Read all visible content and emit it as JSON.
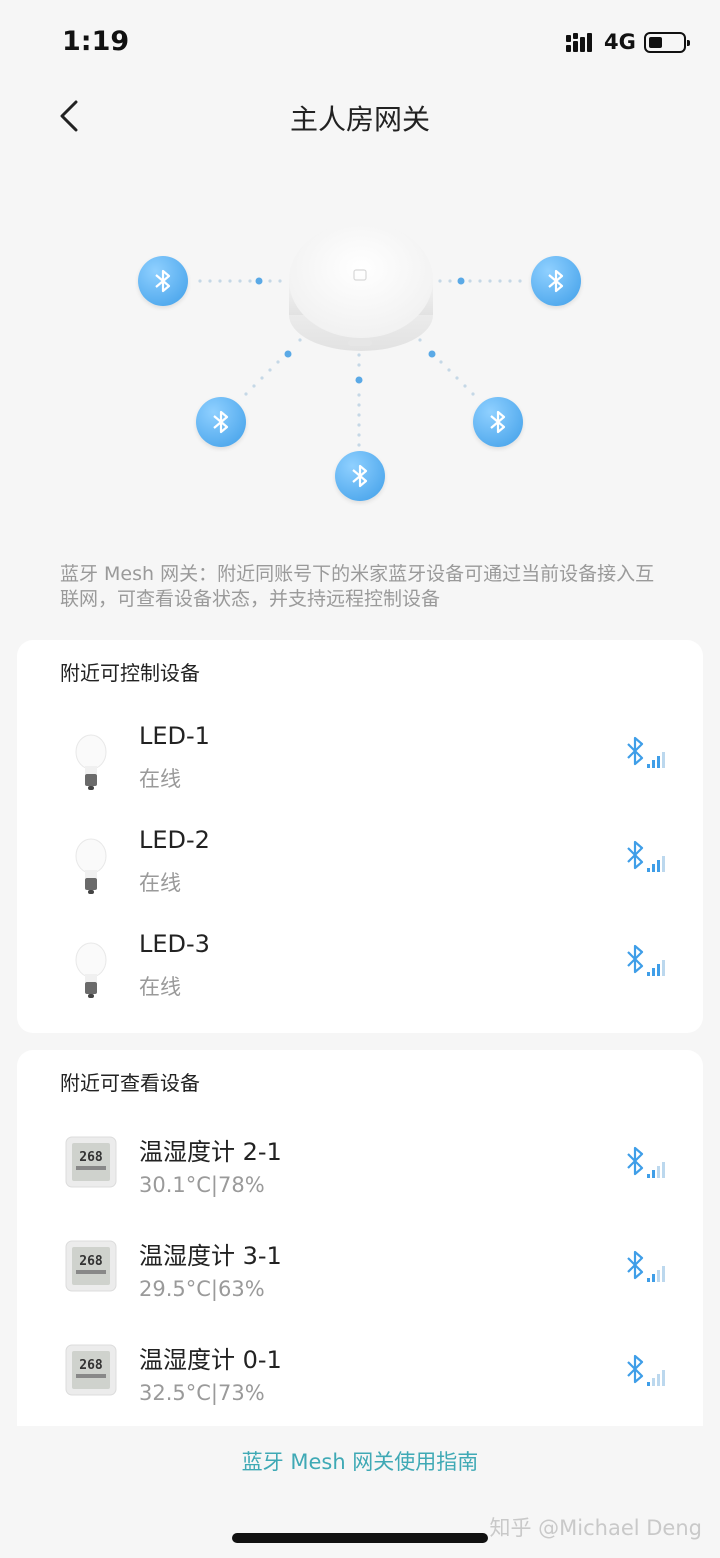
{
  "status_bar": {
    "time": "1:19",
    "network": "4G"
  },
  "nav": {
    "title": "主人房网关"
  },
  "description": "蓝牙 Mesh 网关：附近同账号下的米家蓝牙设备可通过当前设备接入互联网，可查看设备状态，并支持远程控制设备",
  "controllable": {
    "title": "附近可控制设备",
    "items": [
      {
        "name": "LED-1",
        "status": "在线"
      },
      {
        "name": "LED-2",
        "status": "在线"
      },
      {
        "name": "LED-3",
        "status": "在线"
      }
    ]
  },
  "viewable": {
    "title": "附近可查看设备",
    "items": [
      {
        "name": "温湿度计 2-1",
        "status": "30.1°C|78%",
        "lcd": "268"
      },
      {
        "name": "温湿度计 3-1",
        "status": "29.5°C|63%",
        "lcd": "268"
      },
      {
        "name": "温湿度计 0-1",
        "status": "32.5°C|73%",
        "lcd": "268"
      }
    ]
  },
  "guide_link": "蓝牙 Mesh 网关使用指南",
  "watermark": "知乎 @Michael Deng",
  "colors": {
    "accent": "#3fa9b5",
    "bluetooth": "#3f9ee8"
  }
}
